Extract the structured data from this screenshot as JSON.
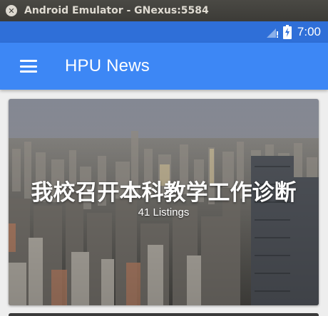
{
  "window": {
    "title": "Android Emulator - GNexus:5584"
  },
  "status_bar": {
    "time": "7:00",
    "colors": {
      "background": "#2f6fd8"
    }
  },
  "app_bar": {
    "title": "HPU News",
    "menu_icon": "hamburger-menu-icon",
    "colors": {
      "background": "#3d87f5"
    }
  },
  "cards": [
    {
      "title": "我校召开本科教学工作诊断",
      "subtitle": "41 Listings",
      "image": "city-skyline-photo"
    }
  ]
}
